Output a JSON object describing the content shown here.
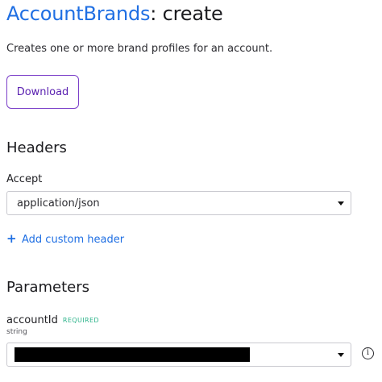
{
  "page": {
    "title_resource": "AccountBrands",
    "title_rest": ": create",
    "description": "Creates one or more brand profiles for an account."
  },
  "actions": {
    "download_label": "Download"
  },
  "headers": {
    "heading": "Headers",
    "accept_label": "Accept",
    "accept_value": "application/json",
    "add_custom_header_label": "Add custom header"
  },
  "parameters": {
    "heading": "Parameters",
    "account_id": {
      "name": "accountId",
      "required_badge": "REQUIRED",
      "type": "string",
      "value_redacted": true
    }
  },
  "colors": {
    "accent_blue": "#1f6fe3",
    "download_purple": "#5b22b1",
    "required_green": "#2bb38a"
  },
  "icons": {
    "select_caret": "caret-down-icon",
    "add": "plus-icon",
    "info": "info-icon"
  }
}
